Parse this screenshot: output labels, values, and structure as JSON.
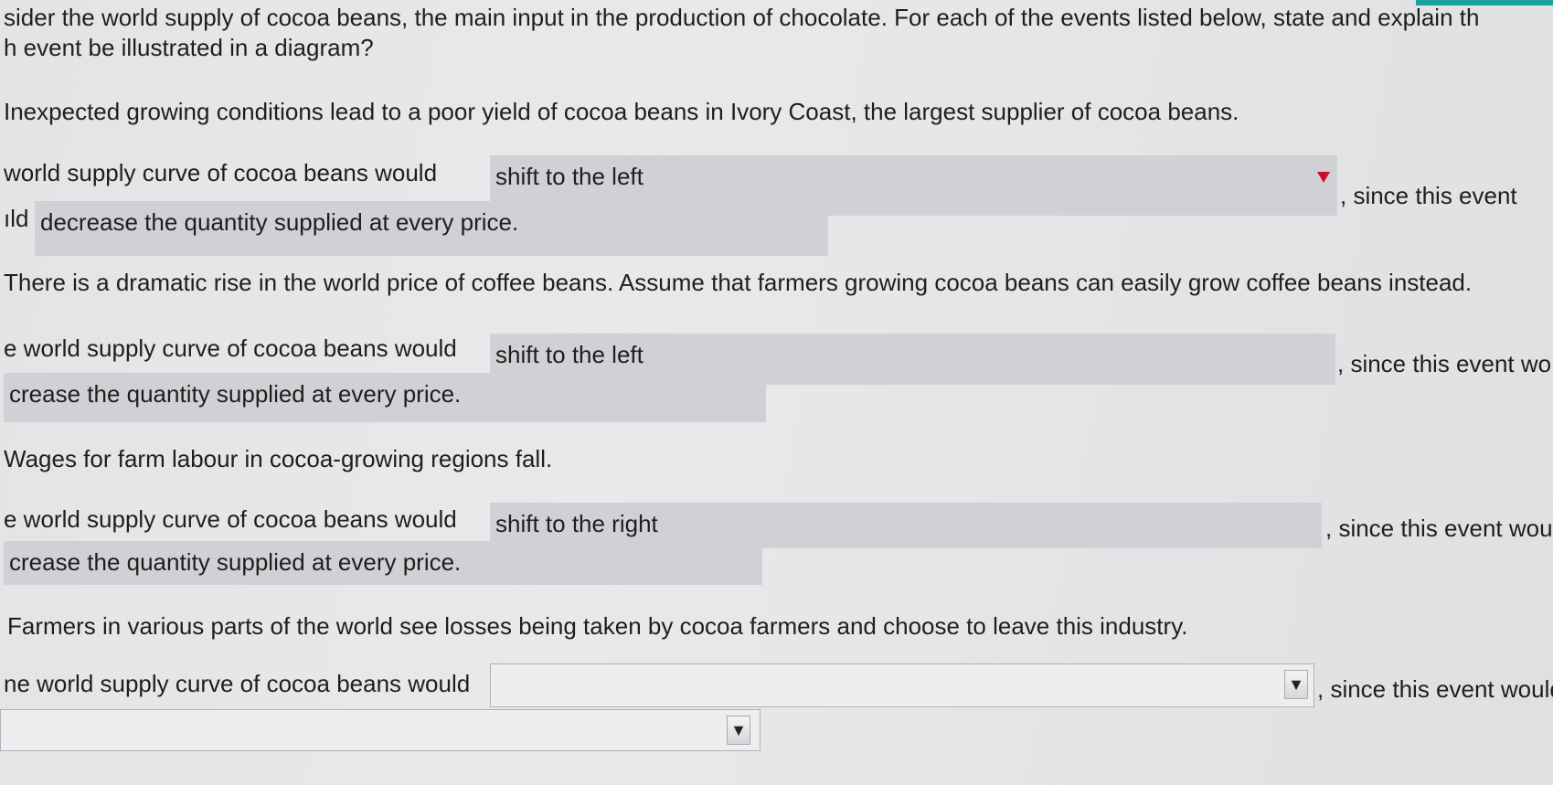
{
  "intro": {
    "line1": "sider the world supply of cocoa beans, the main input in the production of chocolate. For each of the events listed below, state and explain th",
    "line2": "h event be illustrated in a diagram?"
  },
  "q1": {
    "event": "Inexpected growing conditions lead to a poor yield of cocoa beans in Ivory Coast, the largest supplier of cocoa beans.",
    "prefix": "world supply curve of cocoa beans would",
    "answer1": "shift to the left",
    "suffix": ", since this event",
    "line2_prefix": "ıld",
    "answer2": "decrease the quantity supplied at every price."
  },
  "q2": {
    "event": "There is a dramatic rise in the world price of coffee beans. Assume that farmers growing cocoa beans can easily grow coffee beans instead.",
    "prefix": "e world supply curve of cocoa beans would",
    "answer1": "shift to the left",
    "suffix": ", since this event wo",
    "answer2": "crease the quantity supplied at every price."
  },
  "q3": {
    "event": "Wages for farm labour in cocoa-growing regions fall.",
    "prefix": "e world supply curve of cocoa beans would",
    "answer1": "shift to the right",
    "suffix": ", since this event woul",
    "answer2": "crease the quantity supplied at every price."
  },
  "q4": {
    "event": "Farmers in various parts of the world see losses being taken by cocoa farmers and choose to leave this industry.",
    "prefix": "ne world supply curve of cocoa beans would",
    "answer1": "",
    "suffix": ", since this event would",
    "answer2": ""
  },
  "icons": {
    "dropdown": "▼"
  },
  "colors": {
    "accent": "#1aa2a0",
    "flag": "#c8102e"
  }
}
